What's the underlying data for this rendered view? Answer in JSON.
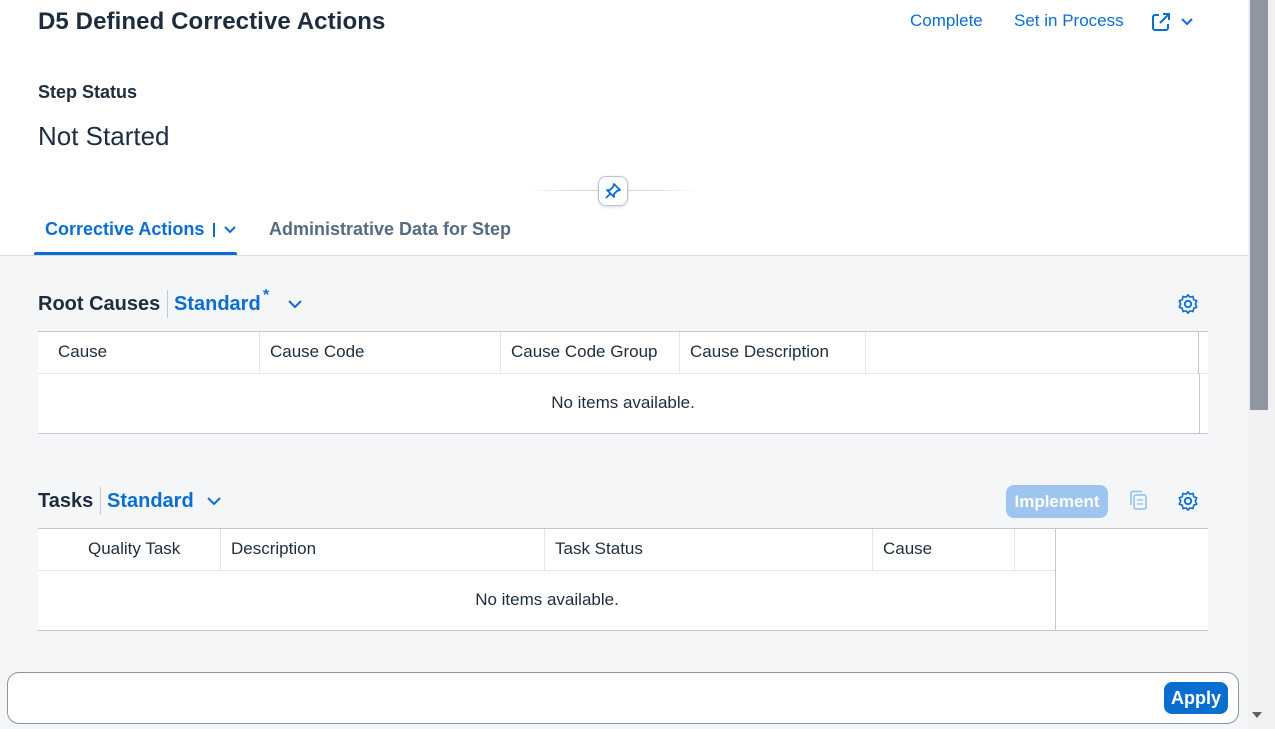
{
  "header": {
    "title": "D5 Defined Corrective Actions",
    "actions": {
      "complete": "Complete",
      "set_in_process": "Set in Process"
    },
    "step_status_label": "Step Status",
    "step_status_value": "Not Started"
  },
  "tabs": [
    {
      "label": "Corrective Actions",
      "active": true
    },
    {
      "label": "Administrative Data for Step",
      "active": false
    }
  ],
  "root_causes": {
    "title": "Root Causes",
    "variant": "Standard",
    "variant_modified_marker": "*",
    "columns": [
      "Cause",
      "Cause Code",
      "Cause Code Group",
      "Cause Description"
    ],
    "empty_text": "No items available."
  },
  "tasks": {
    "title": "Tasks",
    "variant": "Standard",
    "implement_label": "Implement",
    "columns": [
      "Quality Task",
      "Description",
      "Task Status",
      "Cause"
    ],
    "empty_text": "No items available."
  },
  "footer": {
    "apply_label": "Apply"
  },
  "colors": {
    "accent": "#0a6ed1",
    "disabled_button": "#9ec5ef",
    "text": "#1d2d3e"
  }
}
